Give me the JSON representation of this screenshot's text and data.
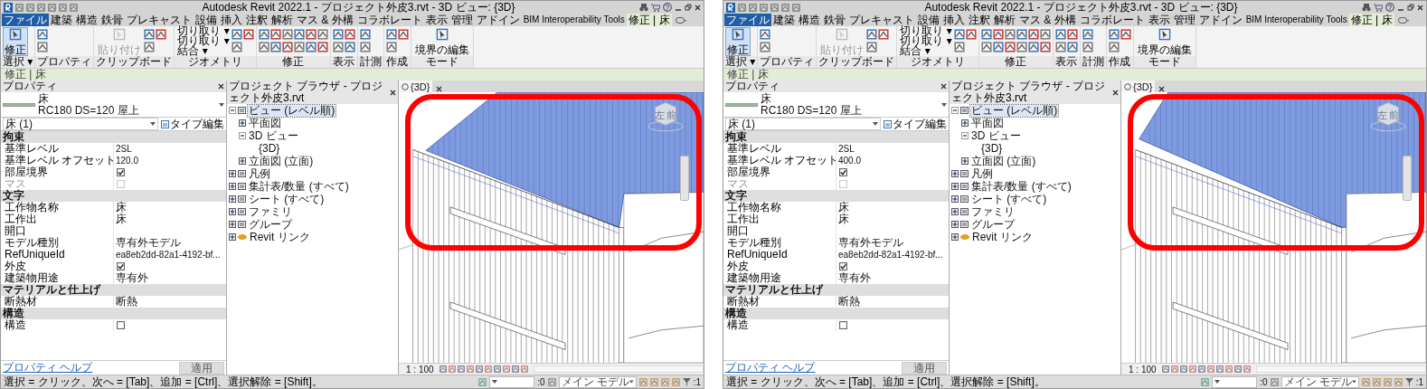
{
  "windows": [
    {
      "title": "Autodesk Revit 2022.1 - プロジェクト外皮3.rvt - 3D ビュー: {3D}",
      "tabs": [
        {
          "label": "ファイル",
          "kind": "file",
          "selected": false
        },
        {
          "label": "建築",
          "kind": "tab",
          "selected": false
        },
        {
          "label": "構造",
          "kind": "tab",
          "selected": false
        },
        {
          "label": "鉄骨",
          "kind": "tab",
          "selected": false
        },
        {
          "label": "プレキャスト",
          "kind": "tab",
          "selected": false
        },
        {
          "label": "設備",
          "kind": "tab",
          "selected": false
        },
        {
          "label": "挿入",
          "kind": "tab",
          "selected": false
        },
        {
          "label": "注釈",
          "kind": "tab",
          "selected": false
        },
        {
          "label": "解析",
          "kind": "tab",
          "selected": false
        },
        {
          "label": "マス & 外構",
          "kind": "tab",
          "selected": false
        },
        {
          "label": "コラボレート",
          "kind": "tab",
          "selected": false
        },
        {
          "label": "表示",
          "kind": "tab",
          "selected": false
        },
        {
          "label": "管理",
          "kind": "tab",
          "selected": false
        },
        {
          "label": "アドイン",
          "kind": "tab",
          "selected": false
        },
        {
          "label": "BIM Interoperability Tools",
          "kind": "tab",
          "selected": false
        },
        {
          "label": "修正 | 床",
          "kind": "context",
          "selected": true
        }
      ],
      "ribbon": [
        {
          "label": "選択 ▾",
          "buttons": [
            {
              "kind": "large",
              "label": "修正",
              "selected": true
            }
          ]
        },
        {
          "label": "プロパティ",
          "buttons": [
            {
              "kind": "icon"
            },
            {
              "kind": "icon"
            }
          ]
        },
        {
          "label": "クリップボード",
          "buttons": [
            {
              "kind": "large",
              "label": "貼り付け",
              "disabled": true
            },
            {
              "kind": "icon"
            },
            {
              "kind": "icon"
            },
            {
              "kind": "icon"
            }
          ]
        },
        {
          "label": "ジオメトリ",
          "buttons": [
            {
              "kind": "small",
              "label": "切り取り ▾"
            },
            {
              "kind": "small",
              "label": "切り取り ▾"
            },
            {
              "kind": "small",
              "label": "結合 ▾"
            },
            {
              "kind": "icon"
            },
            {
              "kind": "icon"
            },
            {
              "kind": "icon"
            }
          ]
        },
        {
          "label": "修正",
          "buttons": [
            {
              "kind": "icon"
            },
            {
              "kind": "icon"
            },
            {
              "kind": "icon"
            },
            {
              "kind": "icon"
            },
            {
              "kind": "icon"
            },
            {
              "kind": "icon"
            },
            {
              "kind": "icon"
            },
            {
              "kind": "icon"
            },
            {
              "kind": "icon"
            },
            {
              "kind": "icon"
            },
            {
              "kind": "icon"
            },
            {
              "kind": "icon"
            }
          ]
        },
        {
          "label": "表示",
          "buttons": [
            {
              "kind": "icon"
            },
            {
              "kind": "icon"
            },
            {
              "kind": "icon"
            },
            {
              "kind": "icon"
            }
          ]
        },
        {
          "label": "計測",
          "buttons": [
            {
              "kind": "icon"
            },
            {
              "kind": "icon"
            }
          ]
        },
        {
          "label": "作成",
          "buttons": [
            {
              "kind": "icon"
            },
            {
              "kind": "icon"
            },
            {
              "kind": "icon"
            }
          ]
        },
        {
          "label": "モード",
          "buttons": [
            {
              "kind": "large",
              "label": "境界の編集",
              "selected": false
            }
          ]
        }
      ],
      "context_label": "修正 | 床",
      "properties": {
        "title": "プロパティ",
        "family": "床",
        "type": "RC180 DS=120 屋上",
        "filter": "床 (1)",
        "type_edit": "タイプ編集",
        "rows": [
          {
            "kind": "group",
            "label": "拘束"
          },
          {
            "kind": "text",
            "label": "基準レベル",
            "value": "2SL"
          },
          {
            "kind": "text",
            "label": "基準レベル オフセット",
            "value": "120.0"
          },
          {
            "kind": "check",
            "label": "部屋境界",
            "checked": true,
            "disabled": false
          },
          {
            "kind": "check",
            "label": "マス",
            "checked": false,
            "disabled": true
          },
          {
            "kind": "group",
            "label": "文字"
          },
          {
            "kind": "text",
            "label": "工作物名称",
            "value": "床"
          },
          {
            "kind": "text",
            "label": "工作出",
            "value": "床"
          },
          {
            "kind": "text",
            "label": "開口",
            "value": ""
          },
          {
            "kind": "text",
            "label": "モデル種別",
            "value": "専有外モデル"
          },
          {
            "kind": "text",
            "label": "RefUniqueId",
            "value": "ea8eb2dd-82a1-4192-bf..."
          },
          {
            "kind": "check",
            "label": "外皮",
            "checked": true,
            "disabled": false
          },
          {
            "kind": "text",
            "label": "建築物用途",
            "value": "専有外"
          },
          {
            "kind": "group",
            "label": "マテリアルと仕上げ"
          },
          {
            "kind": "text",
            "label": "断熱材",
            "value": "断熱"
          },
          {
            "kind": "group",
            "label": "構造"
          },
          {
            "kind": "check",
            "label": "構造",
            "checked": false,
            "disabled": false
          }
        ],
        "help": "プロパティ ヘルプ",
        "apply": "適用"
      },
      "browser": {
        "title": "プロジェクト ブラウザ - プロジェクト外皮3.rvt",
        "tree": [
          {
            "label": "ビュー (レベル順)",
            "kind": "views",
            "expanded": true,
            "selected": true,
            "children": [
              {
                "label": "平面図",
                "expanded": false,
                "selected": false
              },
              {
                "label": "3D ビュー",
                "expanded": true,
                "selected": false,
                "children": [
                  {
                    "label": "{3D}",
                    "selected": false
                  }
                ]
              },
              {
                "label": "立面図 (立面)",
                "expanded": false,
                "selected": false
              }
            ]
          },
          {
            "label": "凡例",
            "kind": "legend",
            "expanded": false,
            "selected": false
          },
          {
            "label": "集計表/数量 (すべて)",
            "kind": "schedule",
            "expanded": false,
            "selected": false
          },
          {
            "label": "シート (すべて)",
            "kind": "sheet",
            "expanded": false,
            "selected": false
          },
          {
            "label": "ファミリ",
            "kind": "family",
            "expanded": false,
            "selected": false
          },
          {
            "label": "グループ",
            "kind": "group",
            "expanded": false,
            "selected": false
          },
          {
            "label": "Revit リンク",
            "kind": "link",
            "expanded": false,
            "selected": false
          }
        ]
      },
      "view": {
        "tab": "{3D}",
        "cube_left": "左",
        "cube_front": "前",
        "scale": "1 : 100"
      },
      "status": {
        "hint": "選択 = クリック、次へ = [Tab]、追加 = [Ctrl]、選択解除 = [Shift]。",
        "count": ":0",
        "model": "メイン モデル",
        "filter": ":1"
      }
    },
    {
      "title": "Autodesk Revit 2022.1 - プロジェクト外皮3.rvt - 3D ビュー: {3D}",
      "tabs": [
        {
          "label": "ファイル",
          "kind": "file",
          "selected": false
        },
        {
          "label": "建築",
          "kind": "tab",
          "selected": false
        },
        {
          "label": "構造",
          "kind": "tab",
          "selected": false
        },
        {
          "label": "鉄骨",
          "kind": "tab",
          "selected": false
        },
        {
          "label": "プレキャスト",
          "kind": "tab",
          "selected": false
        },
        {
          "label": "設備",
          "kind": "tab",
          "selected": false
        },
        {
          "label": "挿入",
          "kind": "tab",
          "selected": false
        },
        {
          "label": "注釈",
          "kind": "tab",
          "selected": false
        },
        {
          "label": "解析",
          "kind": "tab",
          "selected": false
        },
        {
          "label": "マス & 外構",
          "kind": "tab",
          "selected": false
        },
        {
          "label": "コラボレート",
          "kind": "tab",
          "selected": false
        },
        {
          "label": "表示",
          "kind": "tab",
          "selected": false
        },
        {
          "label": "管理",
          "kind": "tab",
          "selected": false
        },
        {
          "label": "アドイン",
          "kind": "tab",
          "selected": false
        },
        {
          "label": "BIM Interoperability Tools",
          "kind": "tab",
          "selected": false
        },
        {
          "label": "修正 | 床",
          "kind": "context",
          "selected": true
        }
      ],
      "ribbon": [
        {
          "label": "選択 ▾",
          "buttons": [
            {
              "kind": "large",
              "label": "修正",
              "selected": true
            }
          ]
        },
        {
          "label": "プロパティ",
          "buttons": [
            {
              "kind": "icon"
            },
            {
              "kind": "icon"
            }
          ]
        },
        {
          "label": "クリップボード",
          "buttons": [
            {
              "kind": "large",
              "label": "貼り付け",
              "disabled": true
            },
            {
              "kind": "icon"
            },
            {
              "kind": "icon"
            },
            {
              "kind": "icon"
            }
          ]
        },
        {
          "label": "ジオメトリ",
          "buttons": [
            {
              "kind": "small",
              "label": "切り取り ▾"
            },
            {
              "kind": "small",
              "label": "切り取り ▾"
            },
            {
              "kind": "small",
              "label": "結合 ▾"
            },
            {
              "kind": "icon"
            },
            {
              "kind": "icon"
            },
            {
              "kind": "icon"
            }
          ]
        },
        {
          "label": "修正",
          "buttons": [
            {
              "kind": "icon"
            },
            {
              "kind": "icon"
            },
            {
              "kind": "icon"
            },
            {
              "kind": "icon"
            },
            {
              "kind": "icon"
            },
            {
              "kind": "icon"
            },
            {
              "kind": "icon"
            },
            {
              "kind": "icon"
            },
            {
              "kind": "icon"
            },
            {
              "kind": "icon"
            },
            {
              "kind": "icon"
            },
            {
              "kind": "icon"
            }
          ]
        },
        {
          "label": "表示",
          "buttons": [
            {
              "kind": "icon"
            },
            {
              "kind": "icon"
            },
            {
              "kind": "icon"
            },
            {
              "kind": "icon"
            }
          ]
        },
        {
          "label": "計測",
          "buttons": [
            {
              "kind": "icon"
            },
            {
              "kind": "icon"
            }
          ]
        },
        {
          "label": "作成",
          "buttons": [
            {
              "kind": "icon"
            },
            {
              "kind": "icon"
            },
            {
              "kind": "icon"
            }
          ]
        },
        {
          "label": "モード",
          "buttons": [
            {
              "kind": "large",
              "label": "境界の編集",
              "selected": false
            }
          ]
        }
      ],
      "context_label": "修正 | 床",
      "properties": {
        "title": "プロパティ",
        "family": "床",
        "type": "RC180 DS=120 屋上",
        "filter": "床 (1)",
        "type_edit": "タイプ編集",
        "rows": [
          {
            "kind": "group",
            "label": "拘束"
          },
          {
            "kind": "text",
            "label": "基準レベル",
            "value": "2SL"
          },
          {
            "kind": "text",
            "label": "基準レベル オフセット",
            "value": "400.0"
          },
          {
            "kind": "check",
            "label": "部屋境界",
            "checked": true,
            "disabled": false
          },
          {
            "kind": "check",
            "label": "マス",
            "checked": false,
            "disabled": true
          },
          {
            "kind": "group",
            "label": "文字"
          },
          {
            "kind": "text",
            "label": "工作物名称",
            "value": "床"
          },
          {
            "kind": "text",
            "label": "工作出",
            "value": "床"
          },
          {
            "kind": "text",
            "label": "開口",
            "value": ""
          },
          {
            "kind": "text",
            "label": "モデル種別",
            "value": "専有外モデル"
          },
          {
            "kind": "text",
            "label": "RefUniqueId",
            "value": "ea8eb2dd-82a1-4192-bf..."
          },
          {
            "kind": "check",
            "label": "外皮",
            "checked": true,
            "disabled": false
          },
          {
            "kind": "text",
            "label": "建築物用途",
            "value": "専有外"
          },
          {
            "kind": "group",
            "label": "マテリアルと仕上げ"
          },
          {
            "kind": "text",
            "label": "断熱材",
            "value": "断熱"
          },
          {
            "kind": "group",
            "label": "構造"
          },
          {
            "kind": "check",
            "label": "構造",
            "checked": false,
            "disabled": false
          }
        ],
        "help": "プロパティ ヘルプ",
        "apply": "適用"
      },
      "browser": {
        "title": "プロジェクト ブラウザ - プロジェクト外皮3.rvt",
        "tree": [
          {
            "label": "ビュー (レベル順)",
            "kind": "views",
            "expanded": true,
            "selected": true,
            "children": [
              {
                "label": "平面図",
                "expanded": false,
                "selected": false
              },
              {
                "label": "3D ビュー",
                "expanded": true,
                "selected": false,
                "children": [
                  {
                    "label": "{3D}",
                    "selected": false
                  }
                ]
              },
              {
                "label": "立面図 (立面)",
                "expanded": false,
                "selected": false
              }
            ]
          },
          {
            "label": "凡例",
            "kind": "legend",
            "expanded": false,
            "selected": false
          },
          {
            "label": "集計表/数量 (すべて)",
            "kind": "schedule",
            "expanded": false,
            "selected": false
          },
          {
            "label": "シート (すべて)",
            "kind": "sheet",
            "expanded": false,
            "selected": false
          },
          {
            "label": "ファミリ",
            "kind": "family",
            "expanded": false,
            "selected": false
          },
          {
            "label": "グループ",
            "kind": "group",
            "expanded": false,
            "selected": false
          },
          {
            "label": "Revit リンク",
            "kind": "link",
            "expanded": false,
            "selected": false
          }
        ]
      },
      "view": {
        "tab": "{3D}",
        "cube_left": "左",
        "cube_front": "前",
        "scale": "1 : 100"
      },
      "status": {
        "hint": "選択 = クリック、次へ = [Tab]、追加 = [Ctrl]、選択解除 = [Shift]。",
        "count": ":0",
        "model": "メイン モデル",
        "filter": ":1"
      }
    }
  ]
}
